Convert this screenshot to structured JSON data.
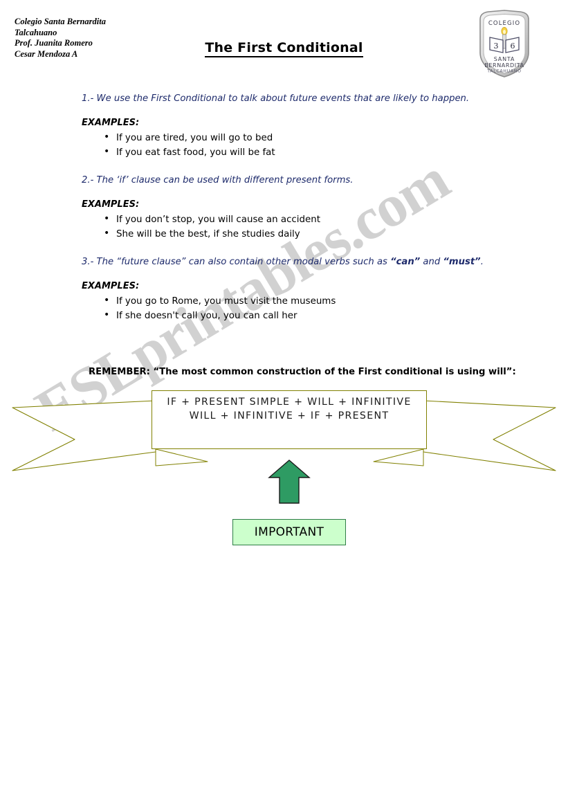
{
  "header": {
    "school_lines": [
      "Colegio Santa Bernardita",
      "Talcahuano",
      "Prof. Juanita Romero",
      "Cesar Mendoza A"
    ],
    "title": "The First Conditional",
    "crest": {
      "top_text": "COLEGIO",
      "name_line1": "SANTA",
      "name_line2": "BERNARDITA",
      "city": "TALCAHUANO",
      "book_left_number": "3",
      "book_right_number": "6"
    }
  },
  "watermark": {
    "text": "ESLprintables.com",
    "color": "#c9c9c9"
  },
  "sections": [
    {
      "rule": "1.- We use the First Conditional to talk about future events that are likely to happen.",
      "examples_label": "EXAMPLES:",
      "examples": [
        "If you are tired, you will go to bed",
        "If you eat fast food, you will be fat"
      ]
    },
    {
      "rule": "2.- The ‘if’ clause can be used with different present forms.",
      "examples_label": "EXAMPLES:",
      "examples": [
        "If you don’t stop, you will cause an accident",
        "She will be the best, if she studies daily"
      ]
    },
    {
      "rule_prefix": "3.- The “future clause” can also contain other modal verbs such as ",
      "rule_bold1": "“can”",
      "rule_mid": " and ",
      "rule_bold2": "“must”",
      "rule_suffix": ".",
      "examples_label": "EXAMPLES:",
      "examples": [
        "If you go to Rome, you must visit the museums",
        "If she doesn't call you, you can call her"
      ]
    }
  ],
  "remember": {
    "text": "REMEMBER: “The most common construction of the First conditional is using will”:"
  },
  "banner": {
    "formula_line1": "IF + PRESENT SIMPLE + WILL + INFINITIVE",
    "formula_line2": "WILL + INFINITIVE + IF + PRESENT",
    "outline_color": "#808000"
  },
  "callout": {
    "arrow_fill": "#2e9b63",
    "arrow_stroke": "#1a1a1a",
    "important_label": "IMPORTANT",
    "important_fill": "#ccffcc",
    "important_border": "#2e7d46"
  },
  "colors": {
    "rule_text": "#1d2a6b",
    "body_text": "#000000",
    "page_background": "#ffffff"
  }
}
